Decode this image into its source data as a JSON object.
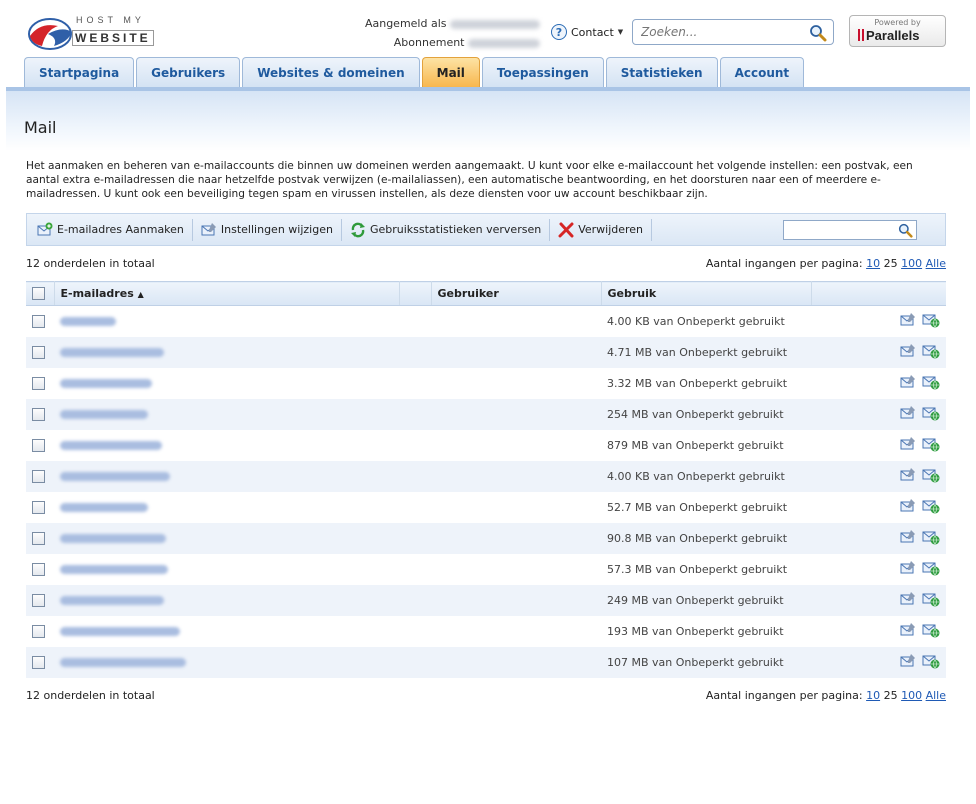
{
  "header": {
    "logo_top": "HOST MY",
    "logo_bottom": "WEBSITE",
    "logged_in_label": "Aangemeld als",
    "subscription_label": "Abonnement",
    "contact_label": "Contact",
    "search_placeholder": "Zoeken...",
    "powered_by": "Powered by",
    "parallels": "Parallels"
  },
  "tabs": [
    {
      "label": "Startpagina",
      "active": false
    },
    {
      "label": "Gebruikers",
      "active": false
    },
    {
      "label": "Websites & domeinen",
      "active": false
    },
    {
      "label": "Mail",
      "active": true
    },
    {
      "label": "Toepassingen",
      "active": false
    },
    {
      "label": "Statistieken",
      "active": false
    },
    {
      "label": "Account",
      "active": false
    }
  ],
  "page": {
    "title": "Mail",
    "description": "Het aanmaken en beheren van e-mailaccounts die binnen uw domeinen werden aangemaakt. U kunt voor elke e-mailaccount het volgende instellen: een postvak, een aantal extra e-mailadressen die naar hetzelfde postvak verwijzen (e-mailaliassen), een automatische beantwoording, en het doorsturen naar een of meerdere e-mailadressen. U kunt ook een beveiliging tegen spam en virussen instellen, als deze diensten voor uw account beschikbaar zijn."
  },
  "toolbar": {
    "create": "E-mailadres Aanmaken",
    "settings": "Instellingen wijzigen",
    "refresh": "Gebruiksstatistieken verversen",
    "delete": "Verwijderen"
  },
  "list": {
    "total_text": "12 onderdelen in totaal",
    "per_page_label": "Aantal ingangen per pagina:",
    "per_page_options": [
      "10",
      "25",
      "100",
      "Alle"
    ],
    "per_page_current": "25",
    "columns": {
      "email": "E-mailadres",
      "user": "Gebruiker",
      "usage": "Gebruik"
    },
    "rows": [
      {
        "usage": "4.00 KB van Onbeperkt gebruikt"
      },
      {
        "usage": "4.71 MB van Onbeperkt gebruikt"
      },
      {
        "usage": "3.32 MB van Onbeperkt gebruikt"
      },
      {
        "usage": "254 MB van Onbeperkt gebruikt"
      },
      {
        "usage": "879 MB van Onbeperkt gebruikt"
      },
      {
        "usage": "4.00 KB van Onbeperkt gebruikt"
      },
      {
        "usage": "52.7 MB van Onbeperkt gebruikt"
      },
      {
        "usage": "90.8 MB van Onbeperkt gebruikt"
      },
      {
        "usage": "57.3 MB van Onbeperkt gebruikt"
      },
      {
        "usage": "249 MB van Onbeperkt gebruikt"
      },
      {
        "usage": "193 MB van Onbeperkt gebruikt"
      },
      {
        "usage": "107 MB van Onbeperkt gebruikt"
      }
    ]
  },
  "colors": {
    "tab_active": "#f7b54b",
    "tab_text": "#1f5a9e",
    "link": "#1f5ab5",
    "row_alt": "#eef3fa"
  }
}
